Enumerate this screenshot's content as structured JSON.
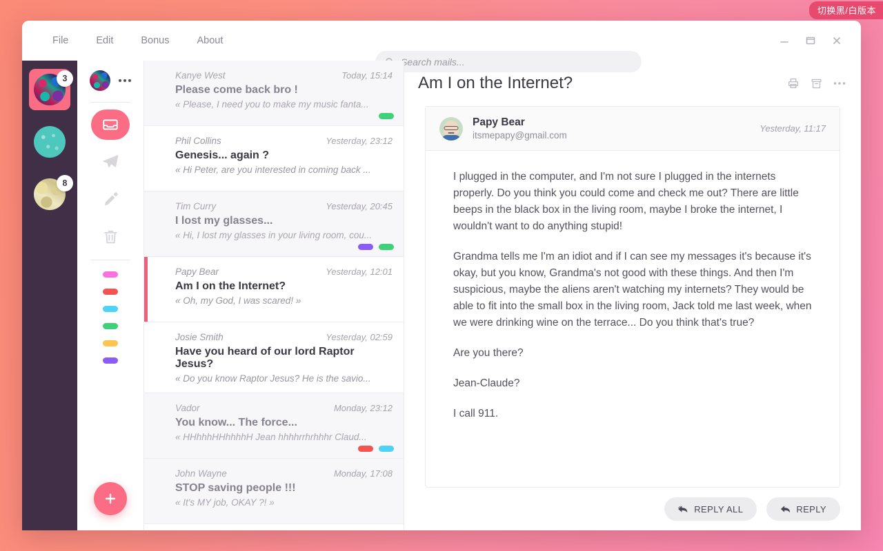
{
  "banner": {
    "label": "切换黑/白版本"
  },
  "titlebar": {
    "menu": [
      {
        "label": "File"
      },
      {
        "label": "Edit"
      },
      {
        "label": "Bonus"
      },
      {
        "label": "About"
      }
    ],
    "search": {
      "placeholder": "Search mails...",
      "value": "",
      "icon": "search-icon"
    },
    "window_controls": [
      {
        "name": "minimize",
        "icon": "minimize-icon"
      },
      {
        "name": "maximize",
        "icon": "maximize-icon"
      },
      {
        "name": "close",
        "icon": "close-icon"
      }
    ]
  },
  "rail": {
    "accounts": [
      {
        "id": "acct-1",
        "badge": "3",
        "active": true
      },
      {
        "id": "acct-2",
        "badge": "",
        "active": false
      },
      {
        "id": "acct-3",
        "badge": "8",
        "active": false
      }
    ]
  },
  "folders": {
    "more_icon": "more-horizontal-icon",
    "items": [
      {
        "name": "inbox",
        "icon": "inbox-icon",
        "active": true
      },
      {
        "name": "sent",
        "icon": "paper-plane-icon",
        "active": false
      },
      {
        "name": "drafts",
        "icon": "pencil-icon",
        "active": false
      },
      {
        "name": "trash",
        "icon": "trash-icon",
        "active": false
      }
    ],
    "tags": [
      {
        "name": "tag-pink",
        "color": "#fb6fe0"
      },
      {
        "name": "tag-red",
        "color": "#f6524f"
      },
      {
        "name": "tag-cyan",
        "color": "#4fd2f8"
      },
      {
        "name": "tag-green",
        "color": "#3fd07a"
      },
      {
        "name": "tag-yellow",
        "color": "#fbc550"
      },
      {
        "name": "tag-purple",
        "color": "#8a5cf5"
      }
    ],
    "compose": {
      "icon": "plus-icon"
    }
  },
  "mail_list": [
    {
      "from": "Kanye West",
      "time": "Today, 15:14",
      "subject": "Please come back bro !",
      "snippet": "« Please, I need you to make my music fanta...",
      "read": true,
      "selected": false,
      "tags": [
        "#3fd07a"
      ]
    },
    {
      "from": "Phil Collins",
      "time": "Yesterday, 23:12",
      "subject": "Genesis... again ?",
      "snippet": "« Hi Peter, are you interested in coming back ...",
      "read": false,
      "selected": false,
      "tags": []
    },
    {
      "from": "Tim Curry",
      "time": "Yesterday, 20:45",
      "subject": "I lost my glasses...",
      "snippet": "« Hi, I lost my glasses in your living room, cou...",
      "read": true,
      "selected": false,
      "tags": [
        "#8a5cf5",
        "#3fd07a"
      ]
    },
    {
      "from": "Papy Bear",
      "time": "Yesterday, 12:01",
      "subject": "Am I on the Internet?",
      "snippet": "« Oh, my God, I was scared! »",
      "read": false,
      "selected": true,
      "tags": []
    },
    {
      "from": "Josie Smith",
      "time": "Yesterday, 02:59",
      "subject": "Have you heard of our lord Raptor Jesus?",
      "snippet": "« Do you know Raptor Jesus? He is the savio...",
      "read": false,
      "selected": false,
      "tags": []
    },
    {
      "from": "Vador",
      "time": "Monday, 23:12",
      "subject": "You know... The force...",
      "snippet": "« HHhhhHHhhhhH Jean hhhhrrhrhhhr Claud...",
      "read": true,
      "selected": false,
      "tags": [
        "#f6524f",
        "#4fd2f8"
      ]
    },
    {
      "from": "John Wayne",
      "time": "Monday, 17:08",
      "subject": "STOP saving people !!!",
      "snippet": "« It's MY job, OKAY ?! »",
      "read": true,
      "selected": false,
      "tags": []
    }
  ],
  "reader": {
    "title": "Am I on the Internet?",
    "actions": [
      {
        "name": "print",
        "icon": "print-icon"
      },
      {
        "name": "archive",
        "icon": "archive-icon"
      },
      {
        "name": "more",
        "icon": "more-horizontal-icon"
      }
    ],
    "message": {
      "sender_name": "Papy Bear",
      "sender_email": "itsmepapy@gmail.com",
      "time": "Yesterday, 11:17",
      "paragraphs": [
        "I plugged in the computer, and I'm not sure I plugged in the internets properly. Do you think you could come and check me out? There are little beeps in the black box in the living room, maybe I broke the internet, I wouldn't want to do anything stupid!",
        "Grandma tells me I'm an idiot and if I can see my messages it's because it's okay, but you know, Grandma's not good with these things. And then I'm suspicious, maybe the aliens aren't watching my internets? They would be able to fit into the small box in the living room, Jack told me last week, when we were drinking wine on the terrace... Do you think that's true?",
        "Are you there?",
        "Jean-Claude?",
        "I call 911."
      ]
    },
    "footer": {
      "reply_all_label": "REPLY ALL",
      "reply_label": "REPLY"
    }
  }
}
